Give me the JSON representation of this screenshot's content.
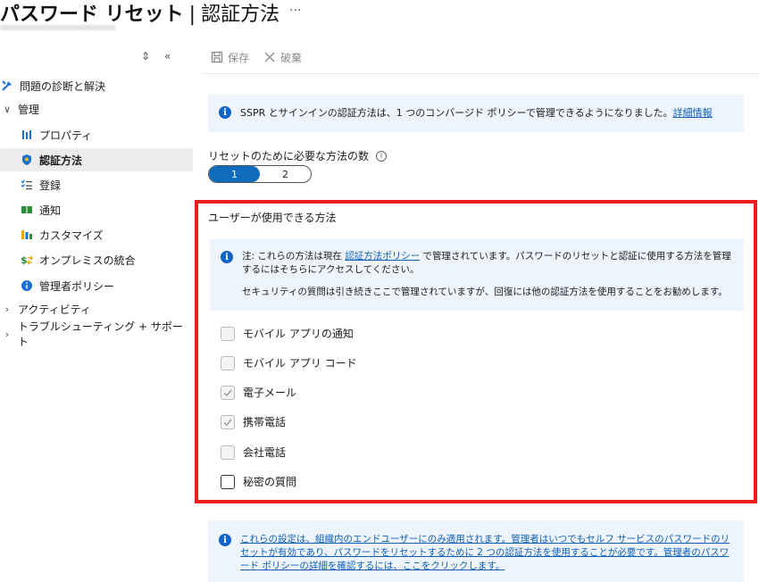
{
  "header": {
    "title": "パスワード リセット",
    "separator": "|",
    "subtitle": "認証方法",
    "more": "···"
  },
  "sidebar": {
    "items": [
      {
        "label": "問題の診断と解決"
      },
      {
        "label": "管理"
      },
      {
        "label": "プロパティ"
      },
      {
        "label": "認証方法"
      },
      {
        "label": "登録"
      },
      {
        "label": "通知"
      },
      {
        "label": "カスタマイズ"
      },
      {
        "label": "オンプレミスの統合"
      },
      {
        "label": "管理者ポリシー"
      },
      {
        "label": "アクティビティ"
      },
      {
        "label": "トラブルシューティング + サポート"
      }
    ]
  },
  "toolbar": {
    "save_label": "保存",
    "discard_label": "破棄"
  },
  "info_banner": {
    "text": "SSPR とサインインの認証方法は、1 つのコンバージド ポリシーで管理できるようになりました。",
    "link": "詳細情報"
  },
  "required_methods": {
    "label": "リセットのために必要な方法の数",
    "options": [
      "1",
      "2"
    ],
    "selected": "1"
  },
  "methods": {
    "title": "ユーザーが使用できる方法",
    "note_prefix": "注: これらの方法は現在 ",
    "note_link": "認証方法ポリシー",
    "note_suffix": " で管理されています。パスワードのリセットと認証に使用する方法を管理するにはそちらにアクセスしてください。",
    "note_line2": "セキュリティの質問は引き続きここで管理されていますが、回復には他の認証方法を使用することをお勧めします。",
    "options": [
      {
        "label": "モバイル アプリの通知",
        "checked": false,
        "enabled": false
      },
      {
        "label": "モバイル アプリ コード",
        "checked": false,
        "enabled": false
      },
      {
        "label": "電子メール",
        "checked": true,
        "enabled": false
      },
      {
        "label": "携帯電話",
        "checked": true,
        "enabled": false
      },
      {
        "label": "会社電話",
        "checked": false,
        "enabled": false
      },
      {
        "label": "秘密の質問",
        "checked": false,
        "enabled": true
      }
    ]
  },
  "footer_banner": {
    "text": "これらの設定は、組織内のエンドユーザーにのみ適用されます。管理者はいつでもセルフ サービスのパスワードのリセットが有効であり、パスワードをリセットするために 2 つの認証方法を使用することが必要です。管理者のパスワード ポリシーの詳細を確認するには、ここをクリックします。"
  },
  "colors": {
    "accent": "#0f6cbd",
    "highlight_border": "#ee1c1c",
    "info_bg": "#eef4fb"
  }
}
